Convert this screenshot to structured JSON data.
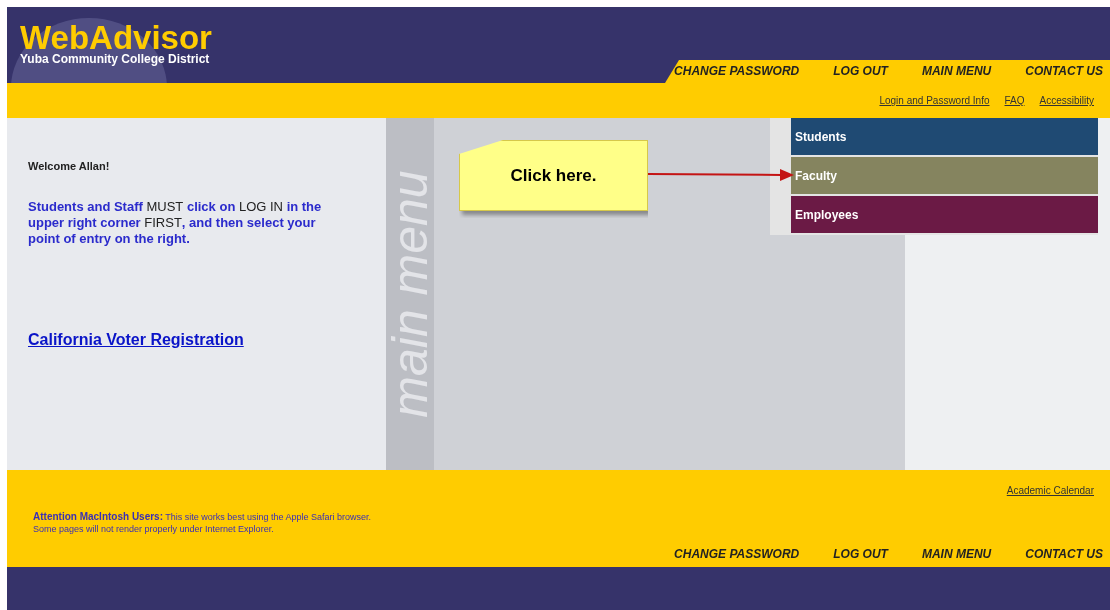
{
  "logo": {
    "title": "WebAdvisor",
    "subtitle": "Yuba Community College District"
  },
  "top_nav": [
    "CHANGE PASSWORD",
    "LOG OUT",
    "MAIN MENU",
    "CONTACT US"
  ],
  "utility_links": [
    "Login and Password Info",
    "FAQ",
    "Accessibility"
  ],
  "welcome": "Welcome Allan!",
  "instructions": "Students and Staff **MUST** click on **LOG IN** in the upper right corner **FIRST**, and then select your point of entry on the right.",
  "voter_link": "California Voter Registration",
  "watermark": "main menu",
  "menu": [
    {
      "label": "Students",
      "color": "#1f4a73"
    },
    {
      "label": "Faculty",
      "color": "#85845f"
    },
    {
      "label": "Employees",
      "color": "#6b1a45"
    }
  ],
  "callout": {
    "text": "Click here."
  },
  "footer": {
    "notice": [
      "**Attention MacIntosh Users:** This site works best using the Apple Safari browser.",
      "Some pages will not render properly under Internet Explorer."
    ],
    "calendar_link": "Academic Calendar"
  },
  "bottom_nav": [
    "CHANGE PASSWORD",
    "LOG OUT",
    "MAIN MENU",
    "CONTACT US"
  ]
}
